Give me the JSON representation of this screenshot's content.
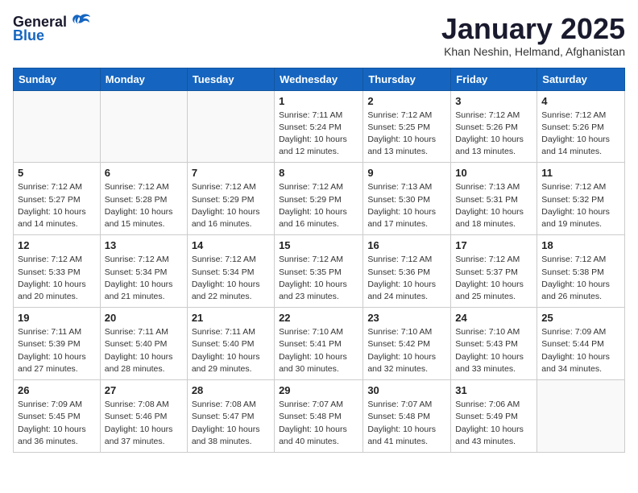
{
  "header": {
    "logo_general": "General",
    "logo_blue": "Blue",
    "month_title": "January 2025",
    "location": "Khan Neshin, Helmand, Afghanistan"
  },
  "days_of_week": [
    "Sunday",
    "Monday",
    "Tuesday",
    "Wednesday",
    "Thursday",
    "Friday",
    "Saturday"
  ],
  "weeks": [
    [
      {
        "day": "",
        "info": ""
      },
      {
        "day": "",
        "info": ""
      },
      {
        "day": "",
        "info": ""
      },
      {
        "day": "1",
        "info": "Sunrise: 7:11 AM\nSunset: 5:24 PM\nDaylight: 10 hours\nand 12 minutes."
      },
      {
        "day": "2",
        "info": "Sunrise: 7:12 AM\nSunset: 5:25 PM\nDaylight: 10 hours\nand 13 minutes."
      },
      {
        "day": "3",
        "info": "Sunrise: 7:12 AM\nSunset: 5:26 PM\nDaylight: 10 hours\nand 13 minutes."
      },
      {
        "day": "4",
        "info": "Sunrise: 7:12 AM\nSunset: 5:26 PM\nDaylight: 10 hours\nand 14 minutes."
      }
    ],
    [
      {
        "day": "5",
        "info": "Sunrise: 7:12 AM\nSunset: 5:27 PM\nDaylight: 10 hours\nand 14 minutes."
      },
      {
        "day": "6",
        "info": "Sunrise: 7:12 AM\nSunset: 5:28 PM\nDaylight: 10 hours\nand 15 minutes."
      },
      {
        "day": "7",
        "info": "Sunrise: 7:12 AM\nSunset: 5:29 PM\nDaylight: 10 hours\nand 16 minutes."
      },
      {
        "day": "8",
        "info": "Sunrise: 7:12 AM\nSunset: 5:29 PM\nDaylight: 10 hours\nand 16 minutes."
      },
      {
        "day": "9",
        "info": "Sunrise: 7:13 AM\nSunset: 5:30 PM\nDaylight: 10 hours\nand 17 minutes."
      },
      {
        "day": "10",
        "info": "Sunrise: 7:13 AM\nSunset: 5:31 PM\nDaylight: 10 hours\nand 18 minutes."
      },
      {
        "day": "11",
        "info": "Sunrise: 7:12 AM\nSunset: 5:32 PM\nDaylight: 10 hours\nand 19 minutes."
      }
    ],
    [
      {
        "day": "12",
        "info": "Sunrise: 7:12 AM\nSunset: 5:33 PM\nDaylight: 10 hours\nand 20 minutes."
      },
      {
        "day": "13",
        "info": "Sunrise: 7:12 AM\nSunset: 5:34 PM\nDaylight: 10 hours\nand 21 minutes."
      },
      {
        "day": "14",
        "info": "Sunrise: 7:12 AM\nSunset: 5:34 PM\nDaylight: 10 hours\nand 22 minutes."
      },
      {
        "day": "15",
        "info": "Sunrise: 7:12 AM\nSunset: 5:35 PM\nDaylight: 10 hours\nand 23 minutes."
      },
      {
        "day": "16",
        "info": "Sunrise: 7:12 AM\nSunset: 5:36 PM\nDaylight: 10 hours\nand 24 minutes."
      },
      {
        "day": "17",
        "info": "Sunrise: 7:12 AM\nSunset: 5:37 PM\nDaylight: 10 hours\nand 25 minutes."
      },
      {
        "day": "18",
        "info": "Sunrise: 7:12 AM\nSunset: 5:38 PM\nDaylight: 10 hours\nand 26 minutes."
      }
    ],
    [
      {
        "day": "19",
        "info": "Sunrise: 7:11 AM\nSunset: 5:39 PM\nDaylight: 10 hours\nand 27 minutes."
      },
      {
        "day": "20",
        "info": "Sunrise: 7:11 AM\nSunset: 5:40 PM\nDaylight: 10 hours\nand 28 minutes."
      },
      {
        "day": "21",
        "info": "Sunrise: 7:11 AM\nSunset: 5:40 PM\nDaylight: 10 hours\nand 29 minutes."
      },
      {
        "day": "22",
        "info": "Sunrise: 7:10 AM\nSunset: 5:41 PM\nDaylight: 10 hours\nand 30 minutes."
      },
      {
        "day": "23",
        "info": "Sunrise: 7:10 AM\nSunset: 5:42 PM\nDaylight: 10 hours\nand 32 minutes."
      },
      {
        "day": "24",
        "info": "Sunrise: 7:10 AM\nSunset: 5:43 PM\nDaylight: 10 hours\nand 33 minutes."
      },
      {
        "day": "25",
        "info": "Sunrise: 7:09 AM\nSunset: 5:44 PM\nDaylight: 10 hours\nand 34 minutes."
      }
    ],
    [
      {
        "day": "26",
        "info": "Sunrise: 7:09 AM\nSunset: 5:45 PM\nDaylight: 10 hours\nand 36 minutes."
      },
      {
        "day": "27",
        "info": "Sunrise: 7:08 AM\nSunset: 5:46 PM\nDaylight: 10 hours\nand 37 minutes."
      },
      {
        "day": "28",
        "info": "Sunrise: 7:08 AM\nSunset: 5:47 PM\nDaylight: 10 hours\nand 38 minutes."
      },
      {
        "day": "29",
        "info": "Sunrise: 7:07 AM\nSunset: 5:48 PM\nDaylight: 10 hours\nand 40 minutes."
      },
      {
        "day": "30",
        "info": "Sunrise: 7:07 AM\nSunset: 5:48 PM\nDaylight: 10 hours\nand 41 minutes."
      },
      {
        "day": "31",
        "info": "Sunrise: 7:06 AM\nSunset: 5:49 PM\nDaylight: 10 hours\nand 43 minutes."
      },
      {
        "day": "",
        "info": ""
      }
    ]
  ]
}
